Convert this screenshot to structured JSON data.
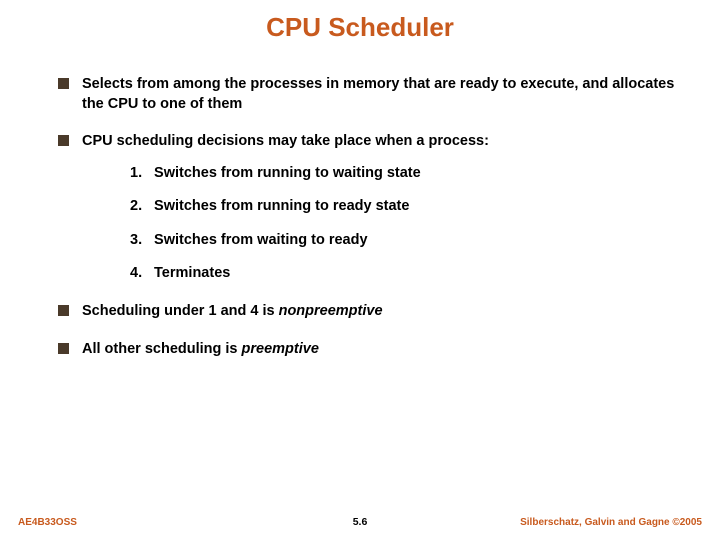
{
  "title": "CPU Scheduler",
  "bullets": {
    "b1": "Selects from among the processes in memory that are ready to execute, and allocates the CPU to one of them",
    "b2": "CPU scheduling decisions may take place when a process:",
    "n1": "Switches from running to waiting state",
    "n2": "Switches from running to ready state",
    "n3": "Switches from waiting to ready",
    "n4": "Terminates",
    "b3_pre": "Scheduling under 1 and 4 is ",
    "b3_em": "nonpreemptive",
    "b4_pre": "All other scheduling is ",
    "b4_em": "preemptive"
  },
  "numbers": {
    "one": "1.",
    "two": "2.",
    "three": "3.",
    "four": "4."
  },
  "footer": {
    "left": "AE4B33OSS",
    "center": "5.6",
    "right": "Silberschatz, Galvin and Gagne ©2005"
  },
  "colors": {
    "accent": "#c85a1e",
    "square": "#4a3a2a"
  }
}
